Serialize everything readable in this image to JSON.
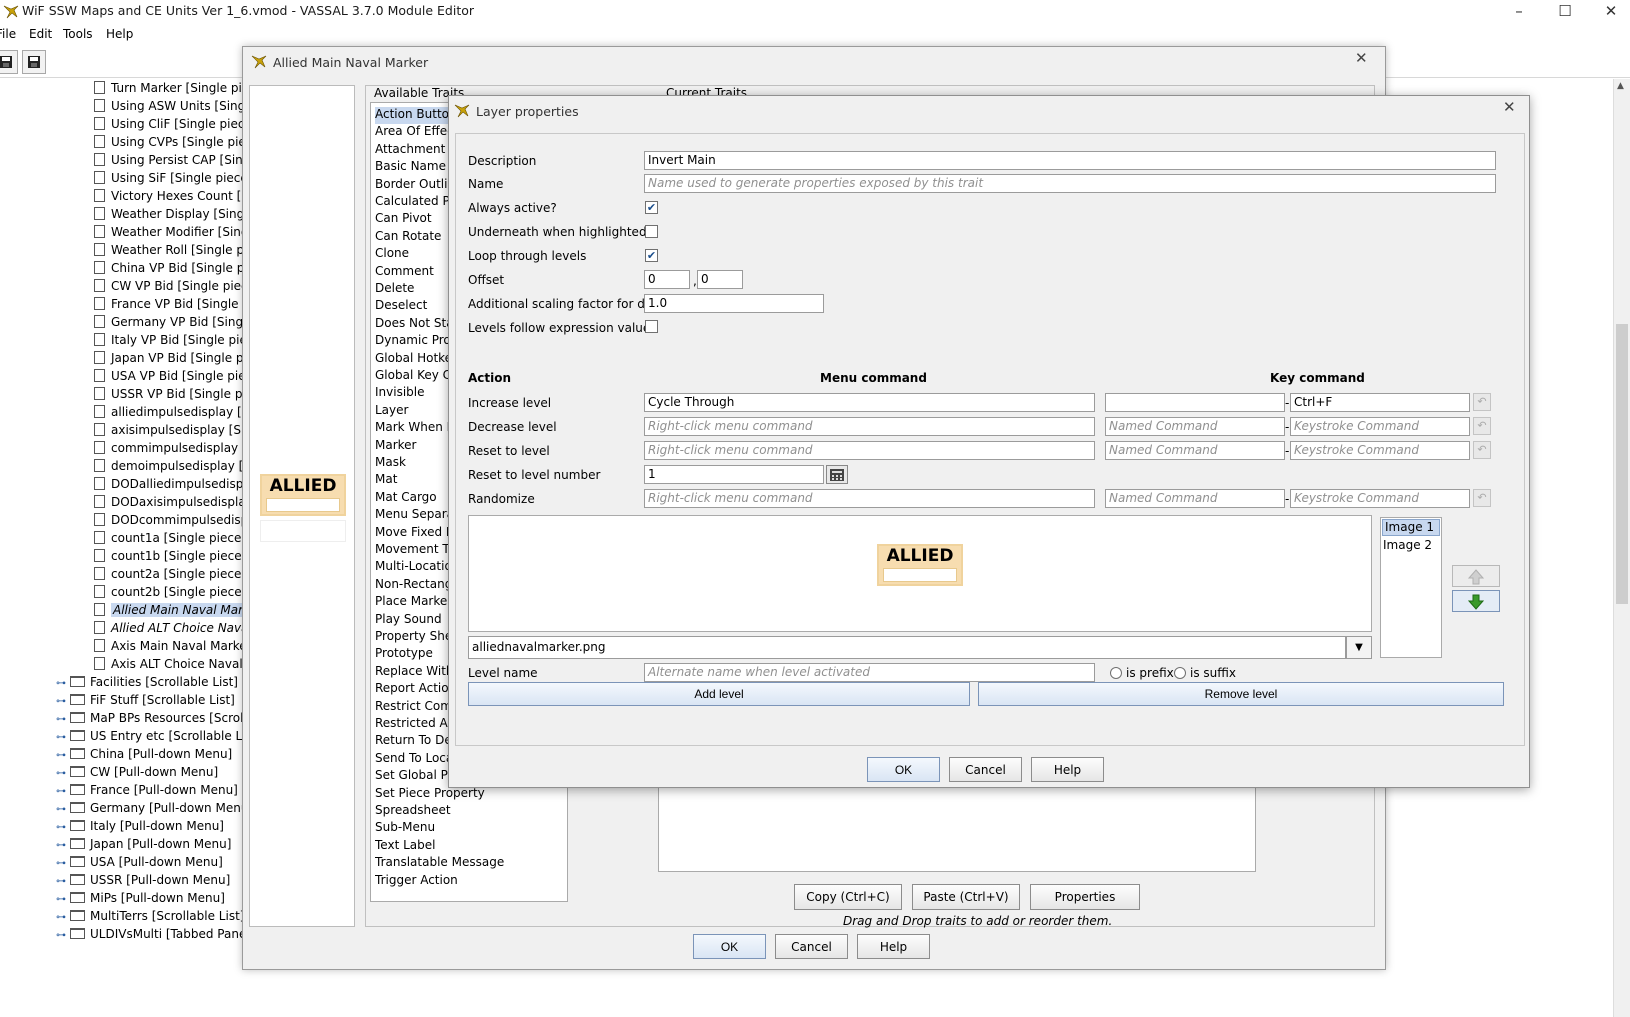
{
  "app": {
    "title": "WiF SSW Maps and CE Units Ver 1_6.vmod - VASSAL 3.7.0 Module Editor",
    "menus": [
      "File",
      "Edit",
      "Tools",
      "Help"
    ]
  },
  "tree": {
    "items": [
      {
        "label": "Turn Marker [Single piece]",
        "type": "piece"
      },
      {
        "label": "Using ASW Units [Single piece]",
        "type": "piece"
      },
      {
        "label": "Using CliF [Single piece]",
        "type": "piece"
      },
      {
        "label": "Using CVPs [Single piece]",
        "type": "piece"
      },
      {
        "label": "Using Persist CAP [Single piece]",
        "type": "piece"
      },
      {
        "label": "Using SiF [Single piece]",
        "type": "piece"
      },
      {
        "label": "Victory Hexes Count [Single piece]",
        "type": "piece"
      },
      {
        "label": "Weather Display [Single piece]",
        "type": "piece"
      },
      {
        "label": "Weather Modifier [Single piece]",
        "type": "piece"
      },
      {
        "label": "Weather Roll [Single piece]",
        "type": "piece"
      },
      {
        "label": "China VP Bid [Single piece]",
        "type": "piece"
      },
      {
        "label": "CW VP Bid [Single piece]",
        "type": "piece"
      },
      {
        "label": "France VP Bid [Single piece]",
        "type": "piece"
      },
      {
        "label": "Germany VP Bid [Single piece]",
        "type": "piece"
      },
      {
        "label": "Italy VP Bid [Single piece]",
        "type": "piece"
      },
      {
        "label": "Japan VP Bid [Single piece]",
        "type": "piece"
      },
      {
        "label": "USA VP Bid [Single piece]",
        "type": "piece"
      },
      {
        "label": "USSR VP Bid [Single piece]",
        "type": "piece"
      },
      {
        "label": "alliedimpulsedisplay [Single piece]",
        "type": "piece"
      },
      {
        "label": "axisimpulsedisplay [Single piece]",
        "type": "piece"
      },
      {
        "label": "commimpulsedisplay [Single piece]",
        "type": "piece"
      },
      {
        "label": "demoimpulsedisplay [Single piece]",
        "type": "piece"
      },
      {
        "label": "DODalliedimpulsedisplay [Single piece]",
        "type": "piece"
      },
      {
        "label": "DODaxisimpulsedisplay [Single piece]",
        "type": "piece"
      },
      {
        "label": "DODcommimpulsedisplay [Single piece]",
        "type": "piece"
      },
      {
        "label": "count1a [Single piece]",
        "type": "piece"
      },
      {
        "label": "count1b [Single piece]",
        "type": "piece"
      },
      {
        "label": "count2a [Single piece]",
        "type": "piece"
      },
      {
        "label": "count2b [Single piece]",
        "type": "piece"
      },
      {
        "label": "Allied Main Naval Marker [Single piece]",
        "type": "piece",
        "state": "selected"
      },
      {
        "label": "Allied ALT Choice Naval Marker [Single piece]",
        "type": "piece",
        "state": "italic"
      },
      {
        "label": "Axis Main Naval Marker [Single piece]",
        "type": "piece"
      },
      {
        "label": "Axis ALT Choice Naval Marker [Single piece]",
        "type": "piece"
      },
      {
        "label": "Facilities [Scrollable List]",
        "type": "folder"
      },
      {
        "label": "FiF Stuff [Scrollable List]",
        "type": "folder"
      },
      {
        "label": "MaP BPs Resources [Scrollable List]",
        "type": "folder"
      },
      {
        "label": "US Entry etc [Scrollable List]",
        "type": "folder"
      },
      {
        "label": "China [Pull-down Menu]",
        "type": "folder"
      },
      {
        "label": "CW [Pull-down Menu]",
        "type": "folder"
      },
      {
        "label": "France [Pull-down Menu]",
        "type": "folder"
      },
      {
        "label": "Germany [Pull-down Menu]",
        "type": "folder"
      },
      {
        "label": "Italy [Pull-down Menu]",
        "type": "folder"
      },
      {
        "label": "Japan [Pull-down Menu]",
        "type": "folder"
      },
      {
        "label": "USA [Pull-down Menu]",
        "type": "folder"
      },
      {
        "label": "USSR [Pull-down Menu]",
        "type": "folder"
      },
      {
        "label": "MiPs [Pull-down Menu]",
        "type": "folder"
      },
      {
        "label": "MultiTerrs [Scrollable List]",
        "type": "folder"
      },
      {
        "label": "ULDIVsMulti [Tabbed Panel]",
        "type": "folder"
      }
    ]
  },
  "piece_dialog": {
    "title": "Allied Main Naval Marker",
    "preview_label": "ALLIED",
    "available_traits_label": "Available Traits",
    "current_traits_label": "Current Traits",
    "available_traits": [
      "Action Button",
      "Area Of Effect",
      "Attachment",
      "Basic Name",
      "Border Outline",
      "Calculated Property",
      "Can Pivot",
      "Can Rotate",
      "Clone",
      "Comment",
      "Delete",
      "Deselect",
      "Does Not Stack",
      "Dynamic Property",
      "Global Hotkey",
      "Global Key Command",
      "Invisible",
      "Layer",
      "Mark When Moved",
      "Marker",
      "Mask",
      "Mat",
      "Mat Cargo",
      "Menu Separator",
      "Move Fixed Distance",
      "Movement Trail",
      "Multi-Location Command",
      "Non-Rectangular",
      "Place Marker",
      "Play Sound",
      "Property Sheet",
      "Prototype",
      "Replace With Other",
      "Report Action",
      "Restrict Commands",
      "Restricted Access",
      "Return To Deck",
      "Send To Location",
      "Set Global Property",
      "Set Piece Property",
      "Spreadsheet",
      "Sub-Menu",
      "Text Label",
      "Translatable Message",
      "Trigger Action"
    ],
    "copy_button": "Copy (Ctrl+C)",
    "paste_button": "Paste (Ctrl+V)",
    "properties_button": "Properties",
    "drag_hint": "Drag and Drop traits to add or reorder them.",
    "ok": "OK",
    "cancel": "Cancel",
    "help": "Help"
  },
  "layer_dialog": {
    "title": "Layer properties",
    "description_label": "Description",
    "description_value": "Invert Main",
    "name_label": "Name",
    "name_placeholder": "Name used to generate properties exposed by this trait",
    "always_active_label": "Always active?",
    "always_active": true,
    "underneath_label": "Underneath when highlighted",
    "underneath": false,
    "loop_label": "Loop through levels",
    "loop": true,
    "offset_label": "Offset",
    "offset_x": "0",
    "offset_y": "0",
    "offset_sep": ",",
    "scaling_label": "Additional scaling factor for draw",
    "scaling_value": "1.0",
    "follow_expr_label": "Levels follow expression value",
    "follow_expr": false,
    "col_action": "Action",
    "col_menu": "Menu command",
    "col_key": "Key command",
    "rows": [
      {
        "label": "Increase level",
        "menu": "Cycle Through",
        "named": "",
        "key": "Ctrl+F"
      },
      {
        "label": "Decrease level",
        "menu": "",
        "named": "",
        "key": ""
      },
      {
        "label": "Reset to level",
        "menu": "",
        "named": "",
        "key": ""
      }
    ],
    "reset_number_label": "Reset to level number",
    "reset_number_value": "1",
    "randomize_label": "Randomize",
    "menu_placeholder": "Right-click menu command",
    "named_placeholder": "Named Command",
    "keystroke_placeholder": "Keystroke Command",
    "key_sep": "-",
    "preview_label": "ALLIED",
    "image_file": "alliednavalmarker.png",
    "images": [
      "Image 1",
      "Image 2"
    ],
    "level_name_label": "Level name",
    "level_name_placeholder": "Alternate name when level activated",
    "is_prefix": "is prefix",
    "is_suffix": "is suffix",
    "add_level": "Add level",
    "remove_level": "Remove level",
    "ok": "OK",
    "cancel": "Cancel",
    "help": "Help"
  },
  "colors": {
    "selection": "#c8d8ef",
    "allied_chip": "#f7ddb0",
    "down_arrow": "#3a9a2a"
  }
}
